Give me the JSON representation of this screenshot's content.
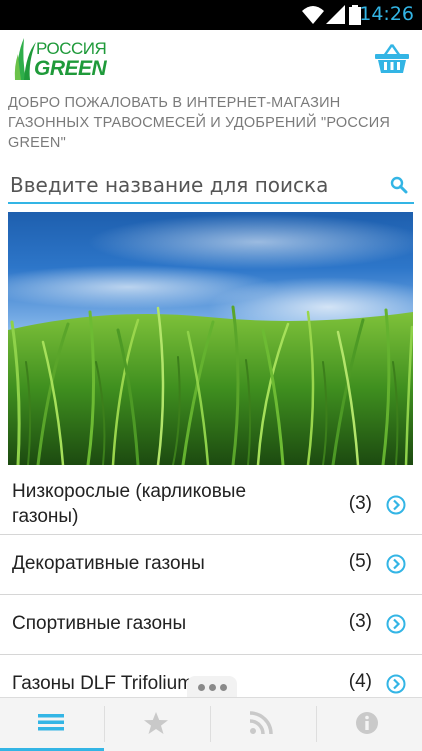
{
  "status_bar": {
    "time": "14:26"
  },
  "header": {
    "logo_line1": "РОССИЯ",
    "logo_line2": "GREEN",
    "cart_icon": "shopping-basket-icon"
  },
  "welcome_text": "ДОБРО ПОЖАЛОВАТЬ В ИНТЕРНЕТ-МАГАЗИН ГАЗОННЫХ ТРАВОСМЕСЕЙ И УДОБРЕНИЙ \"РОССИЯ GREEN\"",
  "search": {
    "placeholder": "Введите название для поиска"
  },
  "categories": [
    {
      "title": "Низкорослые (карликовые газоны)",
      "count": "(3)"
    },
    {
      "title": "Декоративные газоны",
      "count": "(5)"
    },
    {
      "title": "Спортивные газоны",
      "count": "(3)"
    },
    {
      "title": "Газоны DLF Trifolium",
      "count": "(4)"
    }
  ],
  "bottom_tabs": [
    {
      "icon": "menu-icon",
      "selected": true
    },
    {
      "icon": "star-icon",
      "selected": false
    },
    {
      "icon": "rss-icon",
      "selected": false
    },
    {
      "icon": "info-icon",
      "selected": false
    }
  ],
  "colors": {
    "accent": "#33b5e5",
    "brand_green": "#1f9a3a"
  }
}
